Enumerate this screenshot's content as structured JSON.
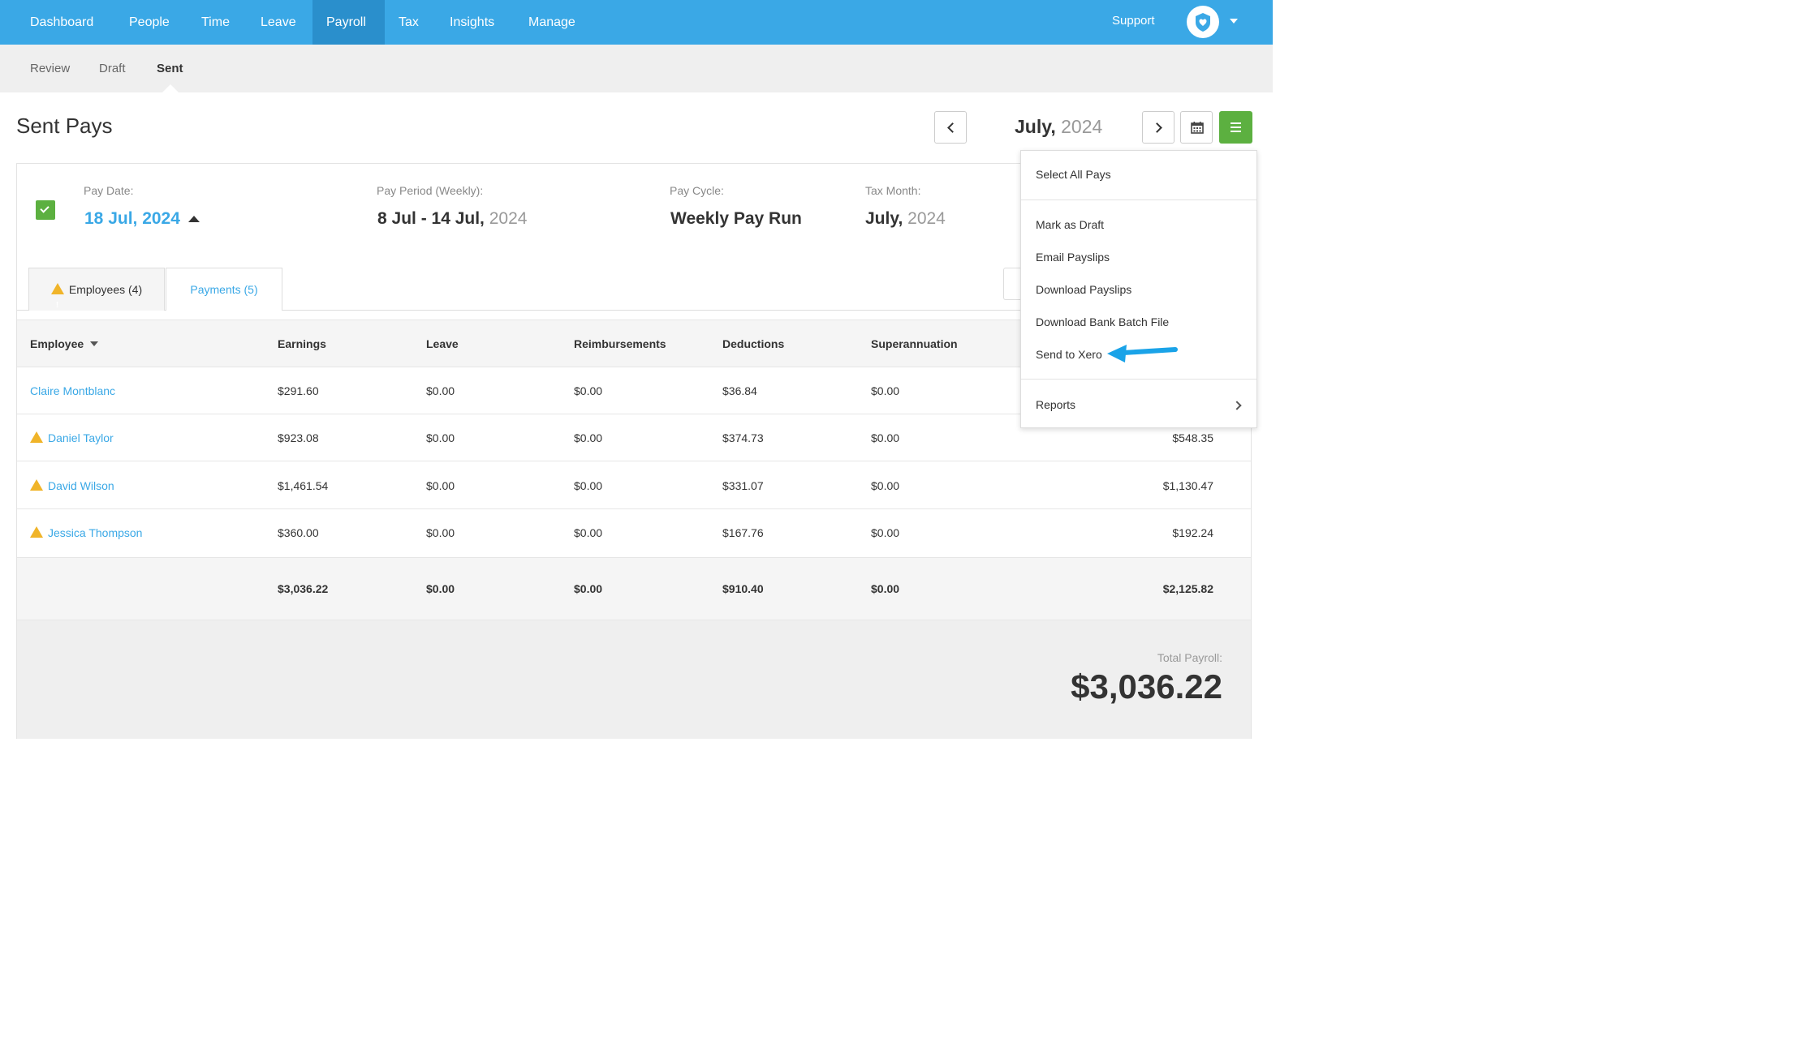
{
  "topnav": {
    "items": [
      {
        "label": "Dashboard",
        "active": false
      },
      {
        "label": "People",
        "active": false
      },
      {
        "label": "Time",
        "active": false
      },
      {
        "label": "Leave",
        "active": false
      },
      {
        "label": "Payroll",
        "active": true
      },
      {
        "label": "Tax",
        "active": false
      },
      {
        "label": "Insights",
        "active": false
      },
      {
        "label": "Manage",
        "active": false
      }
    ],
    "support_label": "Support",
    "avatar_icon": "heart-shield-icon",
    "accent_color": "#3aa8e6"
  },
  "subnav": {
    "items": [
      {
        "label": "Review",
        "active": false
      },
      {
        "label": "Draft",
        "active": false
      },
      {
        "label": "Sent",
        "active": true
      }
    ]
  },
  "header": {
    "title": "Sent Pays",
    "month": "July,",
    "year": "2024"
  },
  "pay_info": {
    "pay_date_label": "Pay Date:",
    "pay_date_value": "18 Jul, 2024",
    "pay_period_label": "Pay Period (Weekly):",
    "pay_period_range": "8 Jul - 14 Jul,",
    "pay_period_year": "2024",
    "pay_cycle_label": "Pay Cycle:",
    "pay_cycle_value": "Weekly Pay Run",
    "tax_month_label": "Tax Month:",
    "tax_month_value": "July,",
    "tax_month_year": "2024"
  },
  "tabs": [
    {
      "label": "Employees (4)",
      "active": true,
      "warning": true
    },
    {
      "label": "Payments (5)",
      "active": false,
      "warning": false
    }
  ],
  "table": {
    "columns": [
      "Employee",
      "Earnings",
      "Leave",
      "Reimbursements",
      "Deductions",
      "Superannuation"
    ],
    "rows": [
      {
        "name": "Claire Montblanc",
        "warning": false,
        "earnings": "$291.60",
        "leave": "$0.00",
        "reimbursements": "$0.00",
        "deductions": "$36.84",
        "super": "$0.00",
        "net": ""
      },
      {
        "name": "Daniel Taylor",
        "warning": true,
        "earnings": "$923.08",
        "leave": "$0.00",
        "reimbursements": "$0.00",
        "deductions": "$374.73",
        "super": "$0.00",
        "net": "$548.35"
      },
      {
        "name": "David Wilson",
        "warning": true,
        "earnings": "$1,461.54",
        "leave": "$0.00",
        "reimbursements": "$0.00",
        "deductions": "$331.07",
        "super": "$0.00",
        "net": "$1,130.47"
      },
      {
        "name": "Jessica Thompson",
        "warning": true,
        "earnings": "$360.00",
        "leave": "$0.00",
        "reimbursements": "$0.00",
        "deductions": "$167.76",
        "super": "$0.00",
        "net": "$192.24"
      }
    ],
    "totals": {
      "earnings": "$3,036.22",
      "leave": "$0.00",
      "reimbursements": "$0.00",
      "deductions": "$910.40",
      "super": "$0.00",
      "net": "$2,125.82"
    }
  },
  "summary": {
    "total_label": "Total Payroll:",
    "total_value": "$3,036.22"
  },
  "dropdown": {
    "items": [
      "Select All Pays",
      "Mark as Draft",
      "Email Payslips",
      "Download Payslips",
      "Download Bank Batch File",
      "Send to Xero",
      "Reports"
    ],
    "highlight_color": "#1aa3e8"
  }
}
